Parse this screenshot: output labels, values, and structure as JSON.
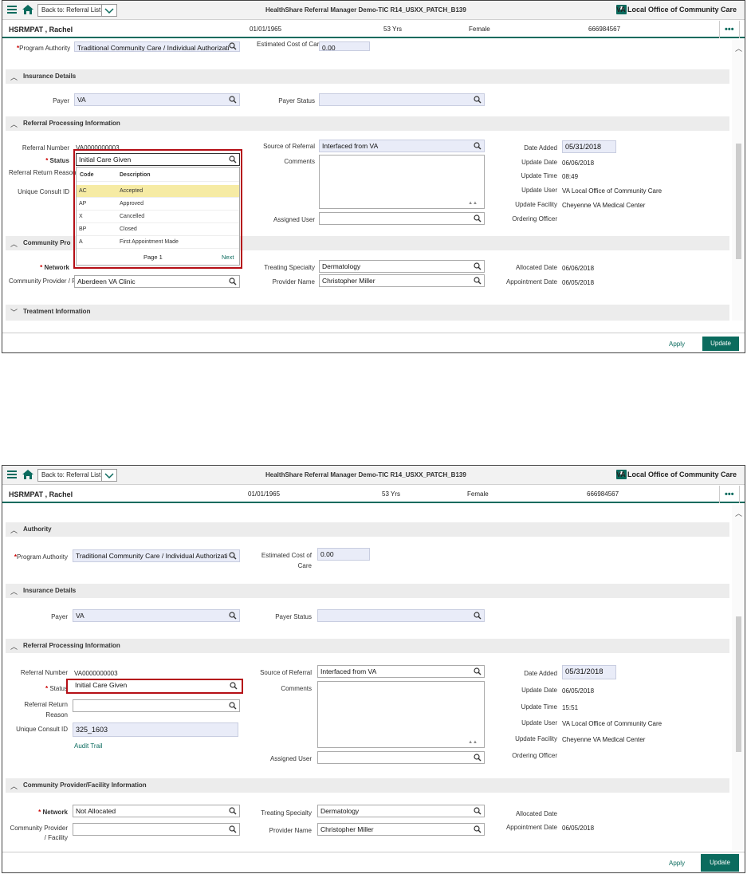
{
  "app": {
    "back_label": "Back to: Referral List",
    "title": "HealthShare Referral Manager Demo-TIC R14_USXX_PATCH_B139",
    "office": "VA Local Office of Community Care"
  },
  "patient": {
    "name": "HSRMPAT , Rachel",
    "dob": "01/01/1965",
    "age": "53 Yrs",
    "sex": "Female",
    "id": "666984567",
    "more": "•••"
  },
  "icons": [
    "hamburger-icon",
    "home-icon",
    "chevron-down-icon",
    "office-icon",
    "search-icon",
    "chevron-up-icon",
    "more-icon"
  ],
  "colors": {
    "accent": "#0b6b5e",
    "highlight": "#b50f16",
    "selected_row": "#f6eba4",
    "input_bg": "#e9ecf8"
  },
  "screen1": {
    "program_authority_label": "Program Authority",
    "program_authority_value": "Traditional Community Care / Individual Authorizati",
    "estimated_cost_label": "Estimated Cost of Care",
    "estimated_cost_value": "0.00",
    "insurance": {
      "section": "Insurance Details",
      "payer_label": "Payer",
      "payer_value": "VA",
      "payer_status_label": "Payer Status",
      "payer_status_value": ""
    },
    "referral": {
      "section": "Referral Processing Information",
      "referral_number_label": "Referral Number",
      "referral_number_value": "VA0000000003",
      "status_label": "Status",
      "status_value": "Initial Care Given",
      "return_reason_label": "Referral Return Reason",
      "consult_label": "Unique Consult ID",
      "source_label": "Source of Referral",
      "source_value": "Interfaced from VA",
      "comments_label": "Comments",
      "assigned_user_label": "Assigned User",
      "date_added_label": "Date Added",
      "date_added_value": "05/31/2018",
      "update_date_label": "Update Date",
      "update_date_value": "06/06/2018",
      "update_time_label": "Update Time",
      "update_time_value": "08:49",
      "update_user_label": "Update User",
      "update_user_value": "VA Local Office of Community Care",
      "update_facility_label": "Update Facility",
      "update_facility_value": "Cheyenne VA Medical Center",
      "ordering_officer_label": "Ordering Officer"
    },
    "dropdown": {
      "code_header": "Code",
      "desc_header": "Description",
      "rows": [
        {
          "code": "AC",
          "desc": "Accepted"
        },
        {
          "code": "AP",
          "desc": "Approved"
        },
        {
          "code": "X",
          "desc": "Cancelled"
        },
        {
          "code": "BP",
          "desc": "Closed"
        },
        {
          "code": "A",
          "desc": "First Appointment Made"
        }
      ],
      "page": "Page 1",
      "next": "Next"
    },
    "community": {
      "section": "Community Pro",
      "network_label": "Network",
      "provider_facility_label": "Community Provider / Facility",
      "provider_facility_value": "Aberdeen VA Clinic",
      "treating_label": "Treating Specialty",
      "treating_value": "Dermatology",
      "provider_name_label": "Provider Name",
      "provider_name_value": "Christopher Miller",
      "allocated_label": "Allocated Date",
      "allocated_value": "06/06/2018",
      "appointment_label": "Appointment Date",
      "appointment_value": "06/05/2018"
    },
    "treatment_section": "Treatment Information",
    "apply": "Apply",
    "update": "Update"
  },
  "screen2": {
    "authority_section": "Authority",
    "program_authority_label": "Program Authority",
    "program_authority_value": "Traditional Community Care / Individual Authorizati",
    "estimated_cost_label": "Estimated Cost of Care",
    "estimated_cost_value": "0.00",
    "insurance": {
      "section": "Insurance Details",
      "payer_label": "Payer",
      "payer_value": "VA",
      "payer_status_label": "Payer Status",
      "payer_status_value": ""
    },
    "referral": {
      "section": "Referral Processing Information",
      "referral_number_label": "Referral Number",
      "referral_number_value": "VA0000000003",
      "status_label": "Status",
      "status_value": "Initial Care Given",
      "return_reason_label": "Referral Return Reason",
      "consult_label": "Unique Consult ID",
      "consult_value": "325_1603",
      "audit_trail": "Audit Trail",
      "source_label": "Source of Referral",
      "source_value": "Interfaced from VA",
      "comments_label": "Comments",
      "assigned_user_label": "Assigned User",
      "date_added_label": "Date Added",
      "date_added_value": "05/31/2018",
      "update_date_label": "Update Date",
      "update_date_value": "06/05/2018",
      "update_time_label": "Update Time",
      "update_time_value": "15:51",
      "update_user_label": "Update User",
      "update_user_value": "VA Local Office of Community Care",
      "update_facility_label": "Update Facility",
      "update_facility_value": "Cheyenne VA Medical Center",
      "ordering_officer_label": "Ordering Officer"
    },
    "community": {
      "section": "Community Provider/Facility Information",
      "network_label": "Network",
      "network_value": "Not Allocated",
      "provider_facility_label": "Community Provider / Facility",
      "provider_facility_value": "",
      "treating_label": "Treating Specialty",
      "treating_value": "Dermatology",
      "provider_name_label": "Provider Name",
      "provider_name_value": "Christopher Miller",
      "allocated_label": "Allocated Date",
      "appointment_label": "Appointment Date",
      "appointment_value": "06/05/2018"
    },
    "apply": "Apply",
    "update": "Update"
  }
}
